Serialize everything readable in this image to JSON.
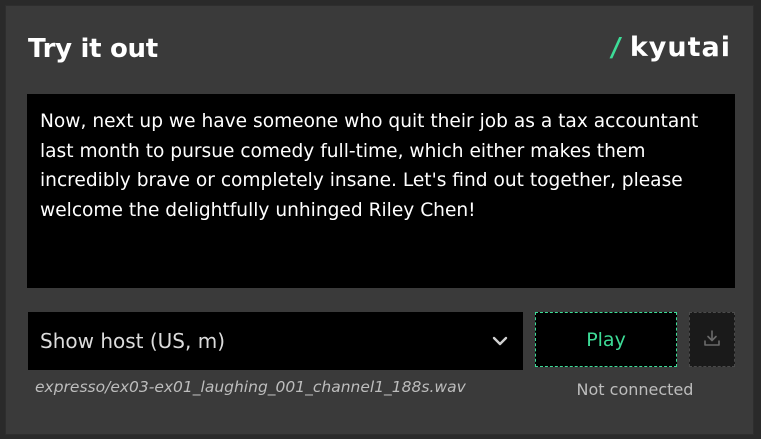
{
  "header": {
    "title": "Try it out",
    "logo_slash": "/",
    "logo_text": "kyutai"
  },
  "input": {
    "text": "Now, next up we have someone who quit their job as a tax accountant last month to pursue comedy full-time, which either makes them incredibly brave or completely insane. Let's find out together, please welcome the delightfully unhinged Riley Chen!"
  },
  "voice_select": {
    "selected": "Show host (US, m)",
    "icon": "chevron-down-icon"
  },
  "file": {
    "name": "expresso/ex03-ex01_laughing_001_channel1_188s.wav"
  },
  "controls": {
    "play_label": "Play",
    "download_icon": "download-icon",
    "status": "Not connected"
  },
  "colors": {
    "accent": "#3ddc97",
    "panel": "#3a3a3a",
    "background": "#2a2a2a",
    "field": "#000000"
  }
}
